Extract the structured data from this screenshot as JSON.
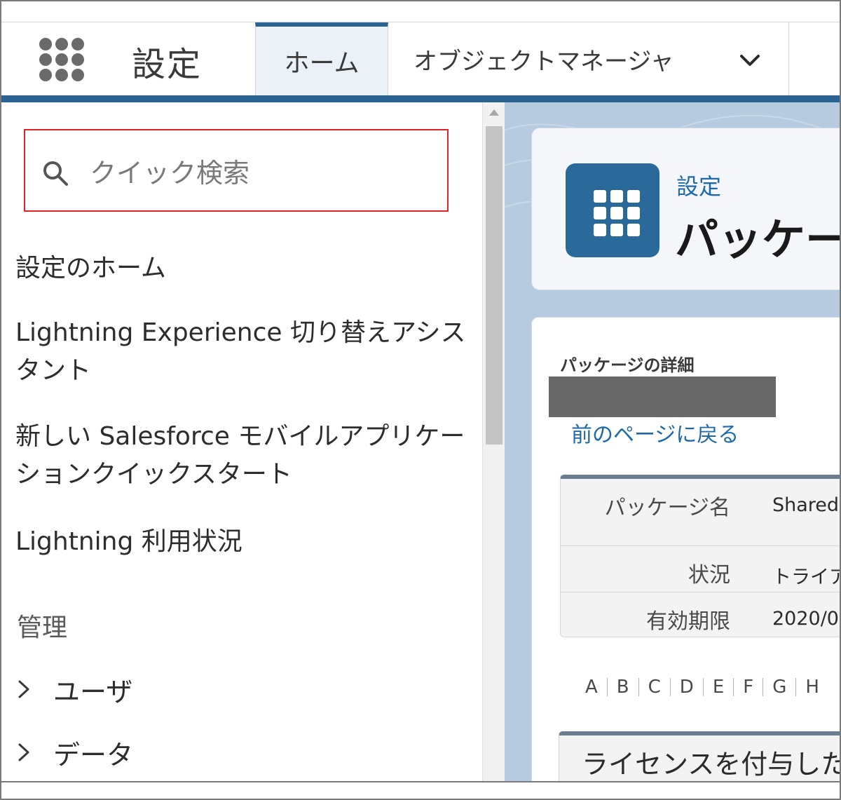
{
  "top_nav": {
    "app_title": "設定",
    "tabs": [
      {
        "label": "ホーム",
        "active": true
      },
      {
        "label": "オブジェクトマネージャ",
        "active": false
      }
    ],
    "accent_color": "#2a6291"
  },
  "sidebar": {
    "search": {
      "placeholder": "クイック検索",
      "value": ""
    },
    "items": [
      {
        "label": "設定のホーム"
      },
      {
        "label": "Lightning Experience 切り替えアシスタント"
      },
      {
        "label": "新しい Salesforce モバイルアプリケーションクイックスタート"
      },
      {
        "label": "Lightning 利用状況"
      }
    ],
    "section_heading": "管理",
    "expandable": [
      {
        "label": "ユーザ"
      },
      {
        "label": "データ"
      }
    ]
  },
  "header": {
    "breadcrumb": "設定",
    "title": "パッケー"
  },
  "content": {
    "section_title": "パッケージの詳細",
    "back_link": "前のページに戻る",
    "details": [
      {
        "key": "パッケージ名",
        "value": "Shared"
      },
      {
        "key": "状況",
        "value": "トライアル"
      },
      {
        "key": "有効期限",
        "value": "2020/0"
      }
    ],
    "alphabet": [
      "A",
      "B",
      "C",
      "D",
      "E",
      "F",
      "G",
      "H"
    ],
    "license_section_title": "ライセンスを付与したユ"
  }
}
